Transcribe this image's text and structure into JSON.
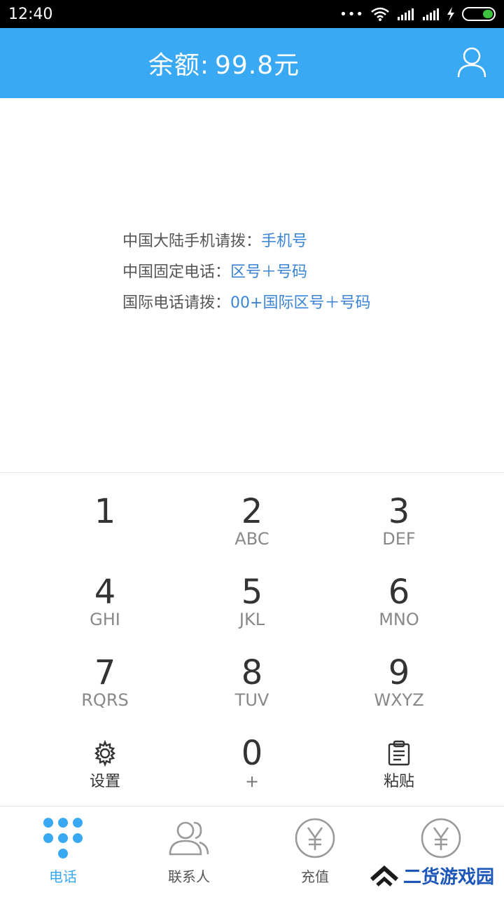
{
  "status_bar": {
    "time": "12:40",
    "dots": "•••"
  },
  "header": {
    "balance_label": "余额:",
    "balance_value": "99.8元"
  },
  "info": [
    {
      "label": "中国大陆手机请拨：",
      "value": "手机号"
    },
    {
      "label": "中国固定电话：",
      "value": "区号＋号码"
    },
    {
      "label": "国际电话请拨：",
      "value": "00+国际区号＋号码"
    }
  ],
  "keys": [
    {
      "num": "1",
      "letters": ""
    },
    {
      "num": "2",
      "letters": "ABC"
    },
    {
      "num": "3",
      "letters": "DEF"
    },
    {
      "num": "4",
      "letters": "GHI"
    },
    {
      "num": "5",
      "letters": "JKL"
    },
    {
      "num": "6",
      "letters": "MNO"
    },
    {
      "num": "7",
      "letters": "RQRS"
    },
    {
      "num": "8",
      "letters": "TUV"
    },
    {
      "num": "9",
      "letters": "WXYZ"
    }
  ],
  "bottom_keys": {
    "settings_label": "设置",
    "zero": "0",
    "zero_sub": "+",
    "paste_label": "粘贴"
  },
  "tabs": [
    {
      "label": "电话",
      "icon": "dialpad-icon"
    },
    {
      "label": "联系人",
      "icon": "contacts-icon"
    },
    {
      "label": "充值",
      "icon": "yen-icon"
    },
    {
      "label": "",
      "icon": "yen-icon"
    }
  ],
  "watermark": {
    "text": "二货游戏园"
  },
  "colors": {
    "accent": "#3aa9f3",
    "link": "#3a84d6"
  }
}
